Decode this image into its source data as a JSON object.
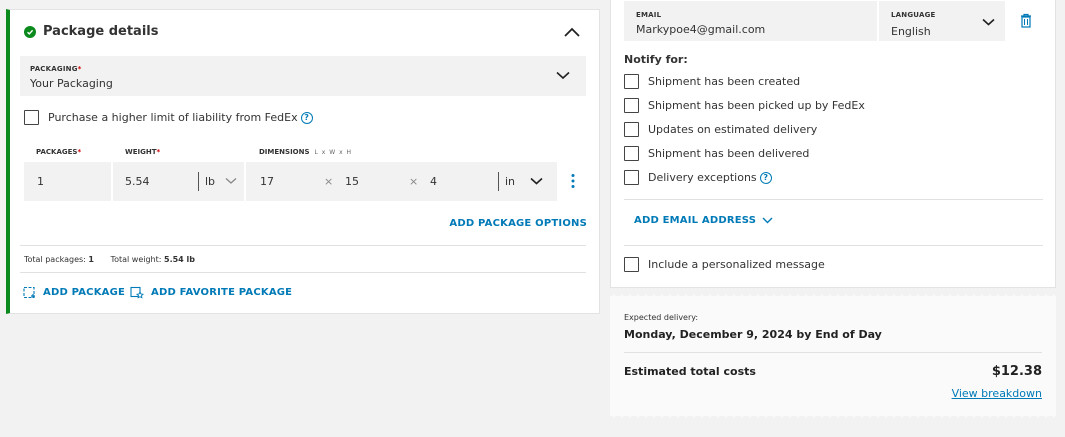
{
  "package_details": {
    "title": "Package details",
    "packaging": {
      "label": "PACKAGING",
      "required_mark": "*",
      "value": "Your Packaging"
    },
    "liability_label": "Purchase a higher limit of liability from FedEx",
    "columns": {
      "packages": "PACKAGES",
      "weight": "WEIGHT",
      "dimensions": "DIMENSIONS",
      "dimensions_hint": "L x W x H",
      "required_mark": "*"
    },
    "row": {
      "packages": "1",
      "weight": "5.54",
      "weight_unit": "lb",
      "length": "17",
      "width": "15",
      "height": "4",
      "dim_unit": "in",
      "times": "×"
    },
    "add_package_options": "ADD PACKAGE OPTIONS",
    "totals": {
      "packages_label": "Total packages:",
      "packages_value": "1",
      "weight_label": "Total weight:",
      "weight_value": "5.54 lb"
    },
    "add_package": "ADD PACKAGE",
    "add_favorite_package": "ADD FAVORITE PACKAGE"
  },
  "notifications": {
    "email_label": "EMAIL",
    "email_value": "Markypoe4@gmail.com",
    "language_label": "LANGUAGE",
    "language_value": "English",
    "notify_for": "Notify for:",
    "options": [
      "Shipment has been created",
      "Shipment has been picked up by FedEx",
      "Updates on estimated delivery",
      "Shipment has been delivered",
      "Delivery exceptions"
    ],
    "add_email_address": "ADD EMAIL ADDRESS",
    "personalized_message": "Include a personalized message"
  },
  "delivery": {
    "expected_label": "Expected delivery:",
    "expected_value": "Monday, December 9, 2024 by End of Day",
    "total_label": "Estimated total costs",
    "total_value": "$12.38",
    "breakdown_link": "View breakdown"
  },
  "colors": {
    "accent_blue": "#007ab7",
    "success_green": "#0a8a1c",
    "required_red": "#c00000"
  }
}
